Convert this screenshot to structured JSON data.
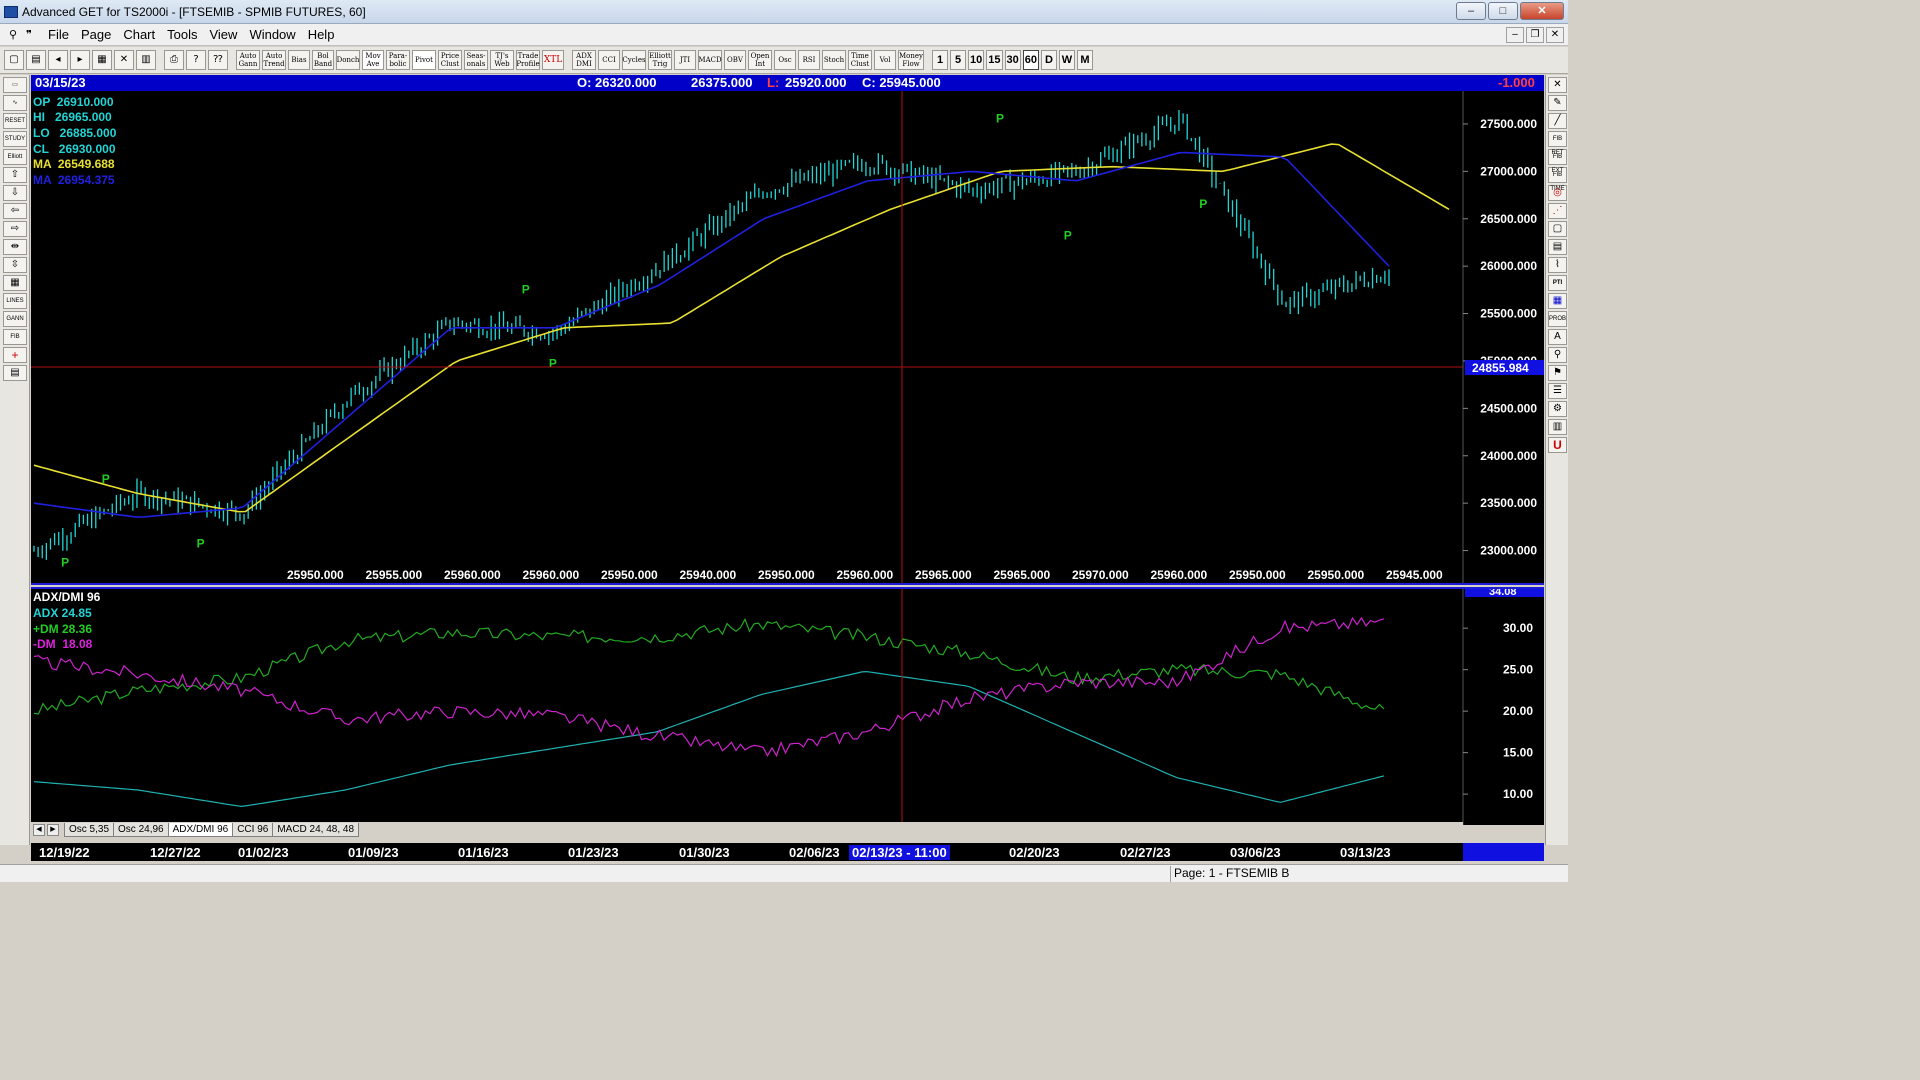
{
  "window": {
    "title": "Advanced GET for TS2000i - [FTSEMIB - SPMIB FUTURES, 60]",
    "controls": {
      "minimize": "–",
      "maximize": "□",
      "close": "✕"
    },
    "mdi_controls": {
      "minimize": "–",
      "restore": "❐",
      "close": "✕"
    }
  },
  "menu": [
    "File",
    "Page",
    "Chart",
    "Tools",
    "View",
    "Window",
    "Help"
  ],
  "toolbar": {
    "buttons": [
      "Auto Gann",
      "Auto Trend",
      "Bias",
      "Bol Band",
      "Donch",
      "Mov Ave",
      "Para-bolic",
      "Pivot",
      "Price Clust",
      "Seas-onals",
      "TJ's Web",
      "Trade Profile",
      "XTL",
      "ADX DMI",
      "CCI",
      "Cycles",
      "Elliott Trig",
      "JTI",
      "MACD",
      "OBV",
      "Open Int",
      "Osc",
      "RSI",
      "Stoch",
      "Time Clust",
      "Vol",
      "Money Flow"
    ],
    "intervals": [
      "1",
      "5",
      "10",
      "15",
      "30",
      "60",
      "D",
      "W",
      "M"
    ],
    "active_interval": "60"
  },
  "left_tools": [
    "RESET",
    "STUDY",
    "Elliott",
    "LINES",
    "GANN",
    "FIB"
  ],
  "right_tools": [
    "FIB RET",
    "FIB EXT",
    "FIB TIME",
    "PTI",
    "PROB",
    "U"
  ],
  "header": {
    "date": "03/15/23",
    "open": "O: 26320.000",
    "high": "26375.000",
    "low_prefix": "L:",
    "low": "25920.000",
    "close": "C: 25945.000",
    "change": "-1.000"
  },
  "info_box": {
    "op": "OP  26910.000",
    "hi": "HI   26965.000",
    "lo": "LO   26885.000",
    "cl": "CL   26930.000",
    "ma1": "MA  26549.688",
    "ma2": "MA  26954.375"
  },
  "price_axis": [
    "27500.000",
    "27000.000",
    "26500.000",
    "26000.000",
    "25500.000",
    "25000.000",
    "24500.000",
    "24000.000",
    "23500.000",
    "23000.000"
  ],
  "cursor_price": "24855.984",
  "pivot_marker": "P",
  "bottom_values": [
    "25950.000",
    "25955.000",
    "25960.000",
    "25960.000",
    "25950.000",
    "25940.000",
    "25950.000",
    "25960.000",
    "25965.000",
    "25965.000",
    "25970.000",
    "25960.000",
    "25950.000",
    "25950.000",
    "25945.000"
  ],
  "indicator": {
    "name": "ADX/DMI 96",
    "adx": "ADX 24.85",
    "plus_dm": "+DM 28.36",
    "minus_dm": "-DM  18.08",
    "axis": [
      "30.00",
      "25.00",
      "20.00",
      "15.00",
      "10.00"
    ],
    "top_value": "34.08"
  },
  "tabs": [
    "Osc 5,35",
    "Osc 24,96",
    "ADX/DMI 96",
    "CCI 96",
    "MACD 24, 48, 48"
  ],
  "active_tab": "ADX/DMI 96",
  "dates": [
    "12/19/22",
    "12/27/22",
    "01/02/23",
    "01/09/23",
    "01/16/23",
    "01/23/23",
    "01/30/23",
    "02/06/23",
    "02/20/23",
    "02/27/23",
    "03/06/23",
    "03/13/23"
  ],
  "cursor_date": "02/13/23 - 11:00",
  "status": "Page: 1 - FTSEMIB B",
  "colors": {
    "price_bars": "#22d4d4",
    "ma_slow": "#e8e030",
    "ma_fast": "#2020e0",
    "pivot": "#22cc22",
    "adx": "#20b0b0",
    "plus_dm": "#22aa22",
    "minus_dm": "#cc22cc",
    "cursor": "#b01010",
    "header_bg": "#0000c8"
  },
  "chart_data": [
    {
      "type": "line",
      "title": "FTSEMIB - SPMIB FUTURES, 60",
      "x": [
        "12/19/22",
        "12/27/22",
        "01/02/23",
        "01/09/23",
        "01/16/23",
        "01/23/23",
        "01/30/23",
        "02/06/23",
        "02/13/23",
        "02/20/23",
        "02/27/23",
        "03/06/23",
        "03/13/23",
        "03/15/23"
      ],
      "ylim": [
        22700,
        27700
      ],
      "series": [
        {
          "name": "Price",
          "values": [
            23000,
            23600,
            23400,
            24600,
            25400,
            25300,
            26000,
            26800,
            27100,
            26800,
            27000,
            27550,
            25600,
            25945
          ]
        },
        {
          "name": "MA",
          "values": [
            23900,
            23600,
            23400,
            24200,
            25000,
            25350,
            25400,
            26100,
            26600,
            27000,
            27050,
            27000,
            27300,
            26600
          ]
        },
        {
          "name": "MA",
          "values": [
            23500,
            23350,
            23450,
            24400,
            25350,
            25350,
            25800,
            26500,
            26900,
            27000,
            26900,
            27200,
            27150,
            26000
          ]
        }
      ],
      "pivots": [
        23000,
        23650,
        23200,
        25650,
        25100,
        27450,
        26450,
        26550
      ]
    },
    {
      "type": "line",
      "title": "ADX/DMI 96",
      "x": [
        "12/19/22",
        "12/27/22",
        "01/02/23",
        "01/09/23",
        "01/16/23",
        "01/23/23",
        "01/30/23",
        "02/06/23",
        "02/13/23",
        "02/20/23",
        "02/27/23",
        "03/06/23",
        "03/13/23",
        "03/15/23"
      ],
      "ylim": [
        7,
        34
      ],
      "series": [
        {
          "name": "ADX",
          "values": [
            11.5,
            10.5,
            8.5,
            10.5,
            13.5,
            15.5,
            17.5,
            22,
            24.8,
            23,
            17.5,
            12,
            9,
            12.2
          ]
        },
        {
          "name": "+DM",
          "values": [
            20,
            22.5,
            24,
            28.5,
            29.5,
            29,
            29,
            30.5,
            29,
            27,
            24,
            25,
            24.5,
            20
          ]
        },
        {
          "name": "-DM",
          "values": [
            26,
            24.5,
            22.5,
            19,
            20,
            19.5,
            17,
            15,
            17.5,
            21.5,
            23.5,
            23.5,
            30,
            30.8
          ]
        }
      ]
    }
  ]
}
